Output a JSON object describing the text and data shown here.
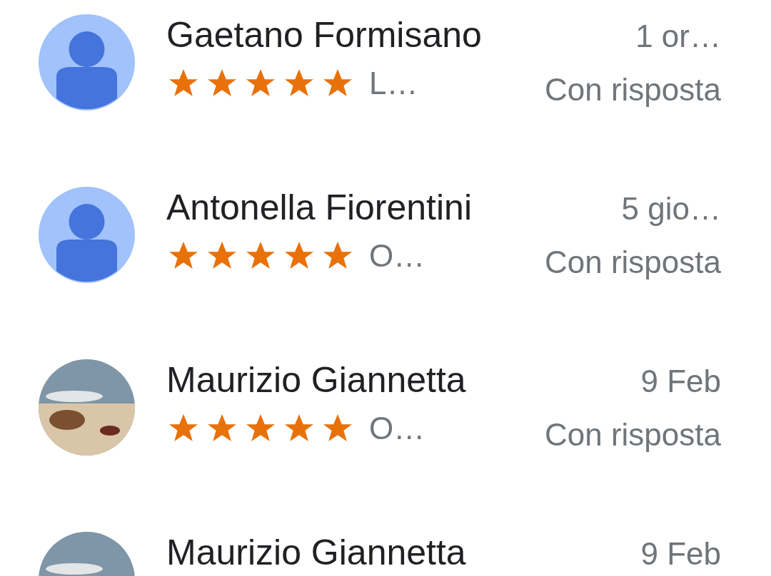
{
  "reviews": [
    {
      "name": "Gaetano Formisano",
      "date": "1 or…",
      "avatar": {
        "kind": "default"
      },
      "stars": 5,
      "snippet": "L…",
      "status": "Con risposta"
    },
    {
      "name": "Antonella Fiorentini",
      "date": "5 gio…",
      "avatar": {
        "kind": "default"
      },
      "stars": 5,
      "snippet": "O…",
      "status": "Con risposta"
    },
    {
      "name": "Maurizio Giannetta",
      "date": "9 Feb",
      "avatar": {
        "kind": "photo"
      },
      "stars": 5,
      "snippet": "O…",
      "status": "Con risposta"
    },
    {
      "name": "Maurizio Giannetta",
      "date": "9 Feb",
      "avatar": {
        "kind": "photo"
      }
    }
  ]
}
